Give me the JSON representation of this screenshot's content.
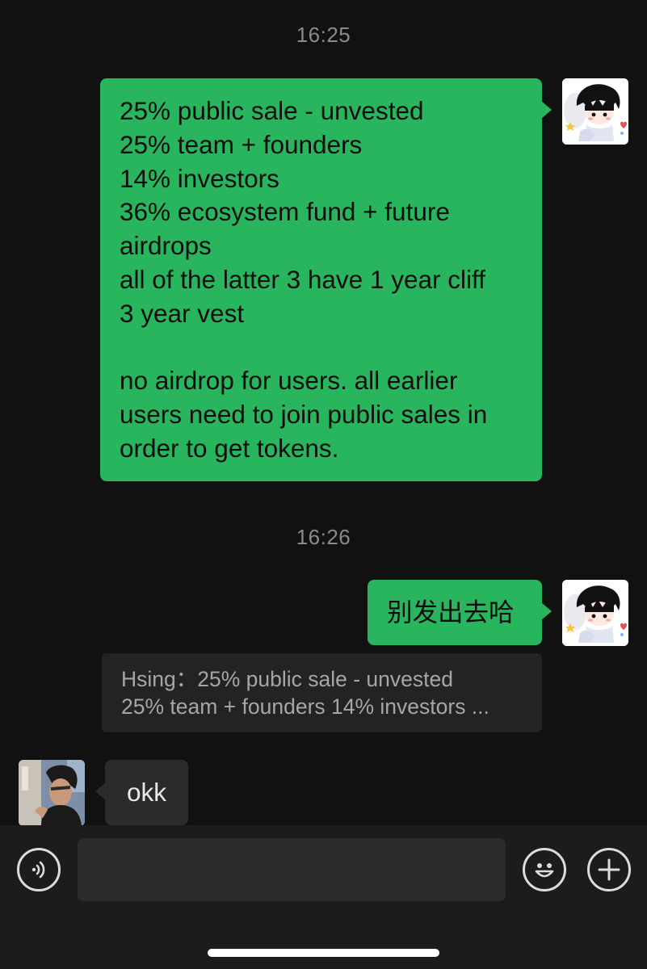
{
  "chat": {
    "timestamp_1": "16:25",
    "message_1": {
      "lines": [
        "25% public sale - unvested",
        "25% team + founders",
        "14% investors",
        "36% ecosystem fund + future",
        "airdrops",
        "all of the latter 3 have 1 year cliff",
        "3 year vest",
        "",
        "no airdrop for users. all earlier",
        "users need to join public sales in",
        "order to get tokens."
      ]
    },
    "timestamp_2": "16:26",
    "message_2": {
      "text": "别发出去哈"
    },
    "quote": {
      "line1": "Hsing：25% public sale - unvested",
      "line2": "25% team + founders 14% investors ..."
    },
    "message_3": {
      "text": "okk"
    }
  },
  "toolbar": {
    "voice_icon": "voice-icon",
    "emoji_icon": "emoji-icon",
    "plus_icon": "plus-icon",
    "input_value": ""
  },
  "colors": {
    "background": "#111111",
    "outgoing_bubble": "#29b45e",
    "incoming_bubble": "#2b2b2b",
    "quote_background": "#232323",
    "toolbar_background": "#1c1c1c"
  }
}
